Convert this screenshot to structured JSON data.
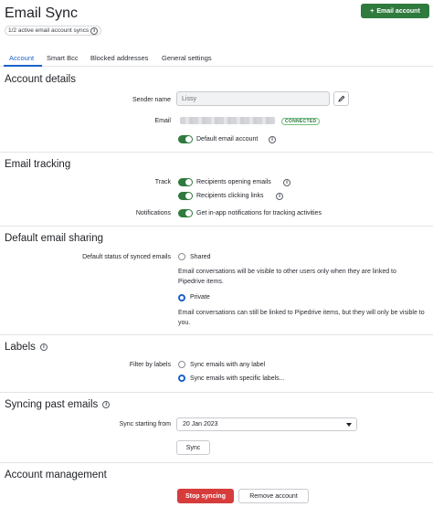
{
  "header": {
    "title": "Email Sync",
    "sync_status": "1/2 active email account syncs",
    "add_button": "Email account"
  },
  "tabs": [
    {
      "label": "Account",
      "active": true
    },
    {
      "label": "Smart Bcc",
      "active": false
    },
    {
      "label": "Blocked addresses",
      "active": false
    },
    {
      "label": "General settings",
      "active": false
    }
  ],
  "account_details": {
    "heading": "Account details",
    "sender_name_label": "Sender name",
    "sender_name_value": "Lissy",
    "email_label": "Email",
    "status_badge": "CONNECTED",
    "default_account_label": "Default email account",
    "default_account_on": true
  },
  "email_tracking": {
    "heading": "Email tracking",
    "track_label": "Track",
    "opening_label": "Recipients opening emails",
    "clicking_label": "Recipients clicking links",
    "notifications_label": "Notifications",
    "notifications_text": "Get in-app notifications for tracking activities"
  },
  "sharing": {
    "heading": "Default email sharing",
    "status_label": "Default status of synced emails",
    "shared_label": "Shared",
    "shared_desc": "Email conversations will be visible to other users only when they are linked to Pipedrive items.",
    "private_label": "Private",
    "private_desc": "Email conversations can still be linked to Pipedrive items, but they will only be visible to you.",
    "selected": "Private"
  },
  "labels": {
    "heading": "Labels",
    "filter_label": "Filter by labels",
    "any_label": "Sync emails with any label",
    "specific_label": "Sync emails with specific labels...",
    "selected": "specific"
  },
  "syncing": {
    "heading": "Syncing past emails",
    "start_label": "Sync starting from",
    "start_value": "20 Jan 2023",
    "sync_button": "Sync"
  },
  "management": {
    "heading": "Account management",
    "stop_button": "Stop syncing",
    "remove_button": "Remove account"
  },
  "colors": {
    "primary_green": "#2f7a3e",
    "link_blue": "#1b61c9",
    "danger_red": "#d63c3c"
  }
}
